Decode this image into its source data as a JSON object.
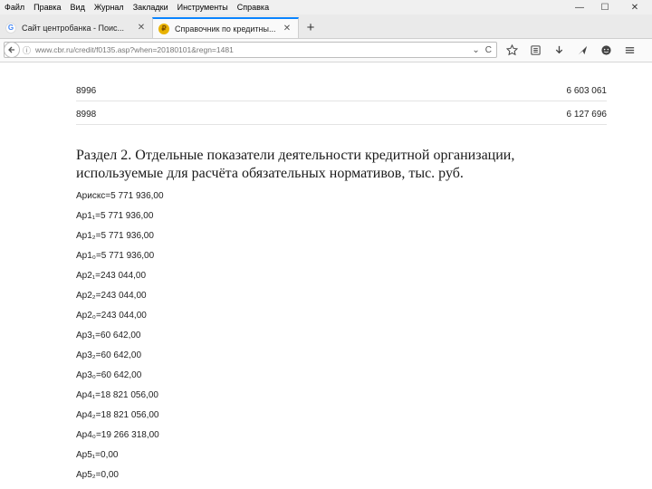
{
  "menubar": {
    "items": [
      "Файл",
      "Правка",
      "Вид",
      "Журнал",
      "Закладки",
      "Инструменты",
      "Справка"
    ]
  },
  "window_controls": {
    "minimize": "—",
    "maximize": "☐",
    "close": "✕"
  },
  "tabs": [
    {
      "title": "Сайт центробанка - Поис...",
      "icon": "google-icon",
      "active": false
    },
    {
      "title": "Справочник по кредитны...",
      "icon": "cbr-icon",
      "active": true
    }
  ],
  "tab_close": "✕",
  "new_tab": "+",
  "navbar": {
    "url": "www.cbr.ru/credit/f0135.asp?when=20180101&regn=1481",
    "dropdown": "⌄",
    "reload": "C"
  },
  "toolbar_icons": [
    "star-icon",
    "reading-list-icon",
    "download-icon",
    "send-icon",
    "smile-icon",
    "menu-icon"
  ],
  "content": {
    "rows": [
      {
        "code": "8996",
        "value": "6 603 061"
      },
      {
        "code": "8998",
        "value": "6 127 696"
      }
    ],
    "section_heading": [
      "Раздел 2. Отдельные показатели деятельности кредитной организации,",
      "используемые для расчёта обязательных нормативов, тыс. руб."
    ],
    "lines": [
      "Арискс=5 771 936,00",
      "Ар1₁=5 771 936,00",
      "Ар1₂=5 771 936,00",
      "Ар1₀=5 771 936,00",
      "Ар2₁=243 044,00",
      "Ар2₂=243 044,00",
      "Ар2₀=243 044,00",
      "Ар3₁=60 642,00",
      "Ар3₂=60 642,00",
      "Ар3₀=60 642,00",
      "Ар4₁=18 821 056,00",
      "Ар4₂=18 821 056,00",
      "Ар4₀=19 266 318,00",
      "Ар5₁=0,00",
      "Ар5₂=0,00"
    ]
  }
}
